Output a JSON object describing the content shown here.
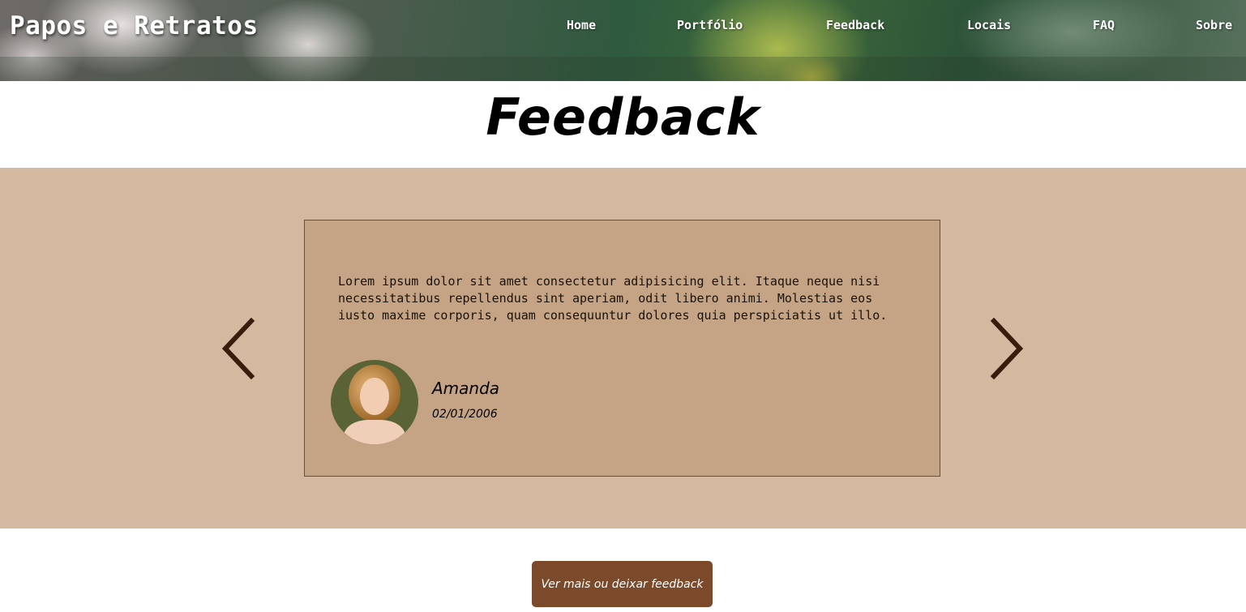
{
  "header": {
    "brand": "Papos e Retratos",
    "nav": [
      {
        "label": "Home"
      },
      {
        "label": "Portfólio"
      },
      {
        "label": "Feedback"
      },
      {
        "label": "Locais"
      },
      {
        "label": "FAQ"
      },
      {
        "label": "Sobre"
      }
    ]
  },
  "section": {
    "title": "Feedback"
  },
  "testimonial": {
    "quote": "Lorem ipsum dolor sit amet consectetur adipisicing elit. Itaque neque nisi necessitatibus repellendus sint aperiam, odit libero animi. Molestias eos iusto maxime corporis, quam consequuntur dolores quia perspiciatis ut illo.",
    "author": "Amanda",
    "date": "02/01/2006"
  },
  "carousel": {
    "prev_icon": "chevron-left-icon",
    "next_icon": "chevron-right-icon"
  },
  "cta": {
    "label": "Ver mais ou deixar feedback"
  },
  "colors": {
    "band": "#d4b9a0",
    "card": "#c5a486",
    "accent": "#7a4a2a",
    "arrow": "#3b1c0c"
  }
}
